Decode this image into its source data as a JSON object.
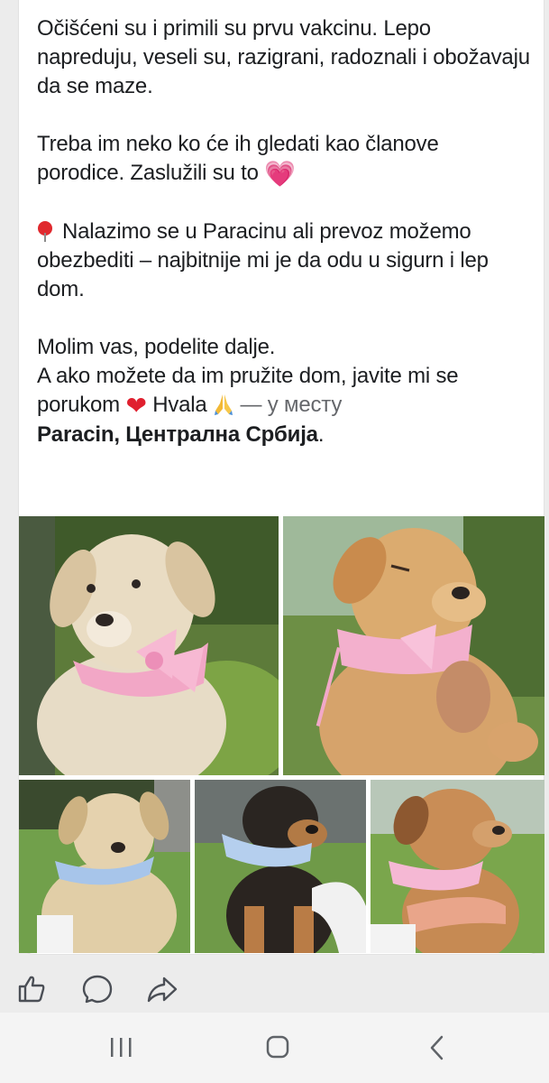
{
  "post": {
    "paragraph1": "Očišćeni su i primili su prvu vakcinu. Lepo napreduju, veseli su, razigrani, radoznali i obožavaju da se maze.",
    "paragraph2_text": "Treba im neko ko će ih gledati kao članove porodice. Zaslužili su to",
    "paragraph2_emoji": "💗",
    "paragraph3_text": "Nalazimo se u Paracinu ali prevoz možemo obezbediti – najbitnije mi je da odu u sigurn i lep dom.",
    "paragraph4_line1": "Molim vas, podelite dalje.",
    "paragraph4_line2": "A ako možete da im pružite dom, javite mi se porukom",
    "heart_emoji": "❤",
    "thanks": "Hvala",
    "location_prefix": "— у месту",
    "location_name": "Paracin, Централна Србија",
    "location_suffix": "."
  },
  "photos": [
    {
      "name": "photo-puppy-cream-pink-collar",
      "collar": "#f4a9c8",
      "fur": "#e8d9bf"
    },
    {
      "name": "photo-puppy-golden-pink-collar",
      "collar": "#f6b3cf",
      "fur": "#d8aa6c"
    },
    {
      "name": "photo-puppy-cream-blue-collar",
      "collar": "#a9c6ea",
      "fur": "#e3cfa9"
    },
    {
      "name": "photo-puppy-black-tan-blue-collar",
      "collar": "#b6d0ee",
      "fur": "#2b2622"
    },
    {
      "name": "photo-puppy-tan-pink-collar",
      "collar": "#f4b6d2",
      "fur": "#c98b52"
    }
  ],
  "icons": {
    "like": "thumbs-up-icon",
    "comment": "comment-icon",
    "share": "share-icon",
    "recent": "recent-apps-icon",
    "home": "home-icon",
    "back": "back-icon"
  },
  "colors": {
    "text": "#1c1e21",
    "muted": "#65676b",
    "navbar": "#f4f4f4",
    "grass": "#6e9b3e"
  }
}
